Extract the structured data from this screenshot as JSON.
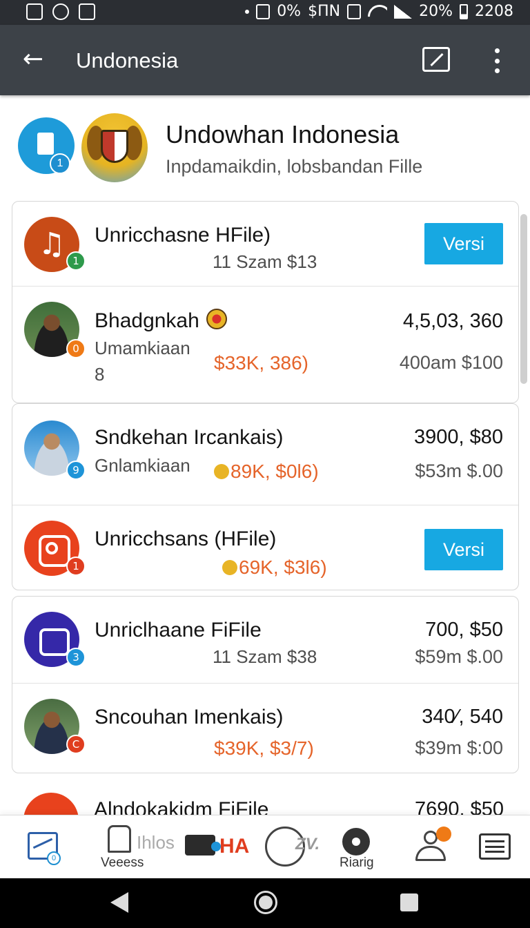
{
  "status_bar": {
    "battery_percent": "0%",
    "signal_percent": "20%",
    "clock": "2208",
    "network_text": "$ΠN"
  },
  "app_bar": {
    "title": "Undonesia"
  },
  "profile": {
    "title": "Undowhan Indonesia",
    "subtitle": "Inpdamaikdin, lobsbandan Fille",
    "app_badge": "1"
  },
  "cards": [
    {
      "rows": [
        {
          "name": "Unricchasne HFile)",
          "sub": "11 Szam $13",
          "button": "Versi",
          "badge": "1"
        },
        {
          "name": "Bhadgnkah",
          "sub_line1": "Umamkiaan",
          "sub_line2": "8",
          "accent": "$33K, 386)",
          "value": "4,5,03, 360",
          "value2": "400am $100",
          "badge": "0"
        }
      ]
    },
    {
      "rows": [
        {
          "name": "Sndkehan Ircankais)",
          "sub": "Gnlamkiaan",
          "accent": "89K, $0l6)",
          "value": "3900, $80",
          "value2": "$53m $.00",
          "badge": "9"
        },
        {
          "name": "Unricchsans (HFile)",
          "accent": "69K, $3l6)",
          "button": "Versi",
          "badge": "1"
        }
      ]
    },
    {
      "rows": [
        {
          "name": "Unriclhaane FiFile",
          "sub": "11 Szam $38",
          "value": "700, $50",
          "value2": "$59m $.00",
          "badge": "3"
        },
        {
          "name": "Sncouhan Imenkais)",
          "accent": "$39K, $3/7)",
          "value": "340⁄, 540",
          "value2": "$39m $:00",
          "badge": "C"
        }
      ]
    }
  ],
  "partial_row": {
    "name": "Alndokakidm FiFile",
    "value": "7690, $50"
  },
  "bottom_nav": {
    "item1_badge": "0",
    "item2_label": "Veeess",
    "item2_ghost": "Ihlos",
    "item3_text": "HA",
    "item4_text": "ZV.",
    "item5_label": "Riarig"
  },
  "colors": {
    "app_bar": "#3d4248",
    "status_bar": "#2b2e33",
    "accent_orange": "#e5642a",
    "button_blue": "#17a8e2"
  }
}
